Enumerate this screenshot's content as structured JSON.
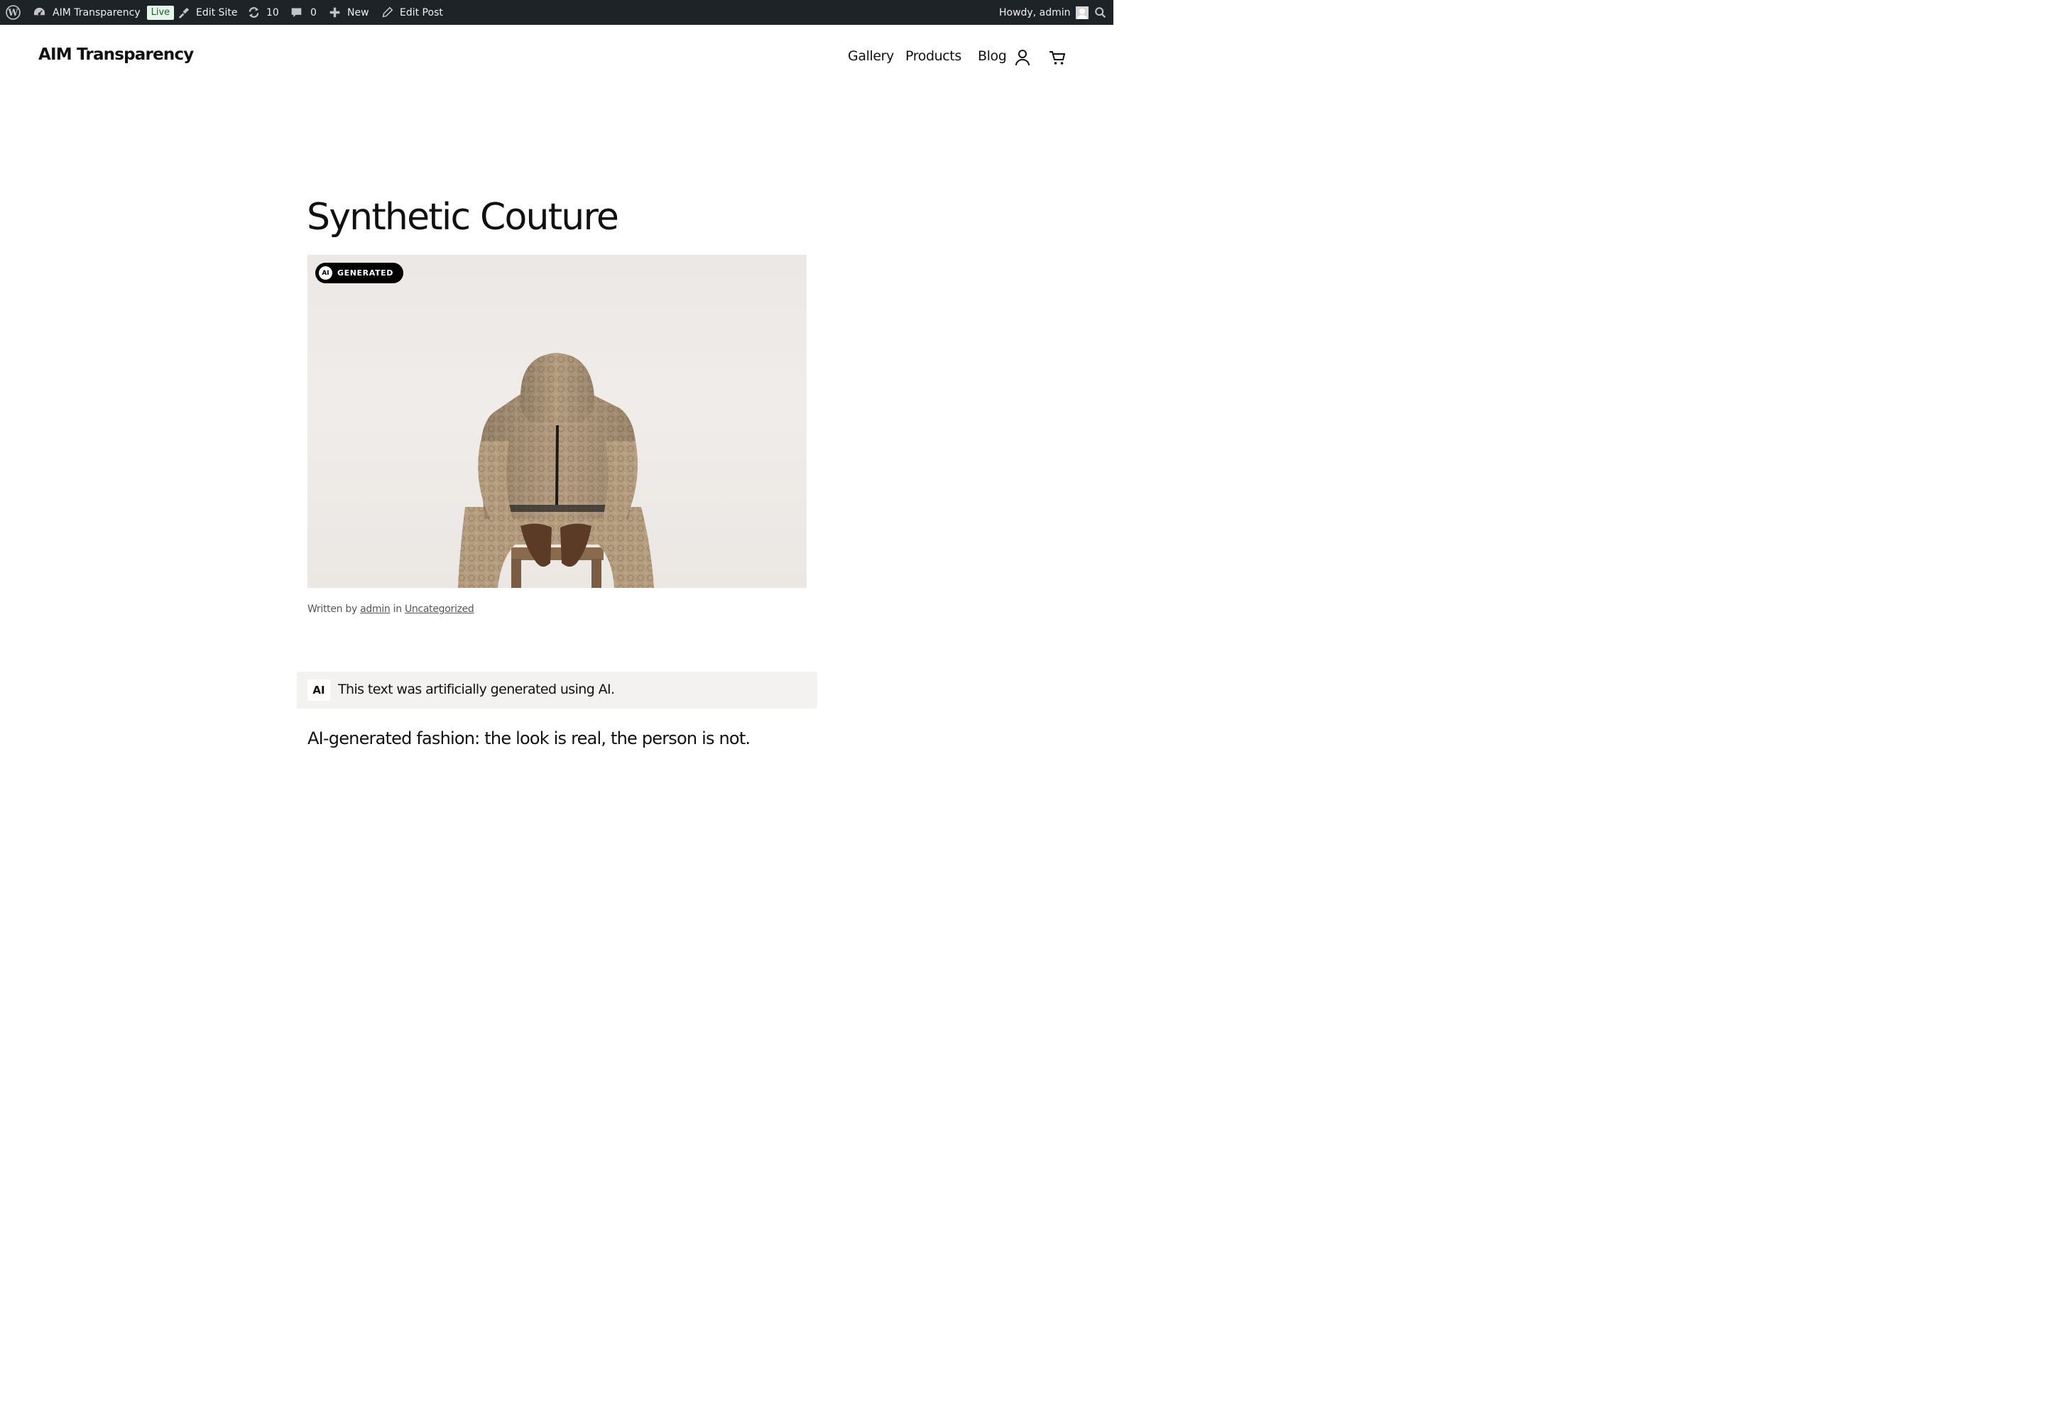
{
  "admin_bar": {
    "wp_logo_icon": "wordpress-icon",
    "site_name": "AIM Transparency",
    "live_badge": "Live",
    "edit_site": "Edit Site",
    "updates_count": "10",
    "comments_count": "0",
    "new_label": "New",
    "edit_post": "Edit Post",
    "greeting": "Howdy, admin",
    "search_icon": "search-icon"
  },
  "header": {
    "site_title": "AIM Transparency",
    "nav": [
      "Gallery",
      "Products",
      "Blog"
    ],
    "account_icon": "user-icon",
    "cart_icon": "cart-icon"
  },
  "post": {
    "title": "Synthetic Couture",
    "badge_mark": "AI",
    "badge_label": "GENERATED",
    "byline_prefix": "Written by",
    "author": "admin",
    "byline_in": "in",
    "category": "Uncategorized",
    "notice_chip": "AI",
    "notice_text": "This text was artificially generated using AI.",
    "lead": "AI-generated fashion: the look is real, the person is not."
  },
  "colors": {
    "admin_bar_bg": "#1d2327",
    "live_badge_bg": "#e7f6ea",
    "notice_bg": "#f4f2f0",
    "badge_bg": "#000000"
  }
}
